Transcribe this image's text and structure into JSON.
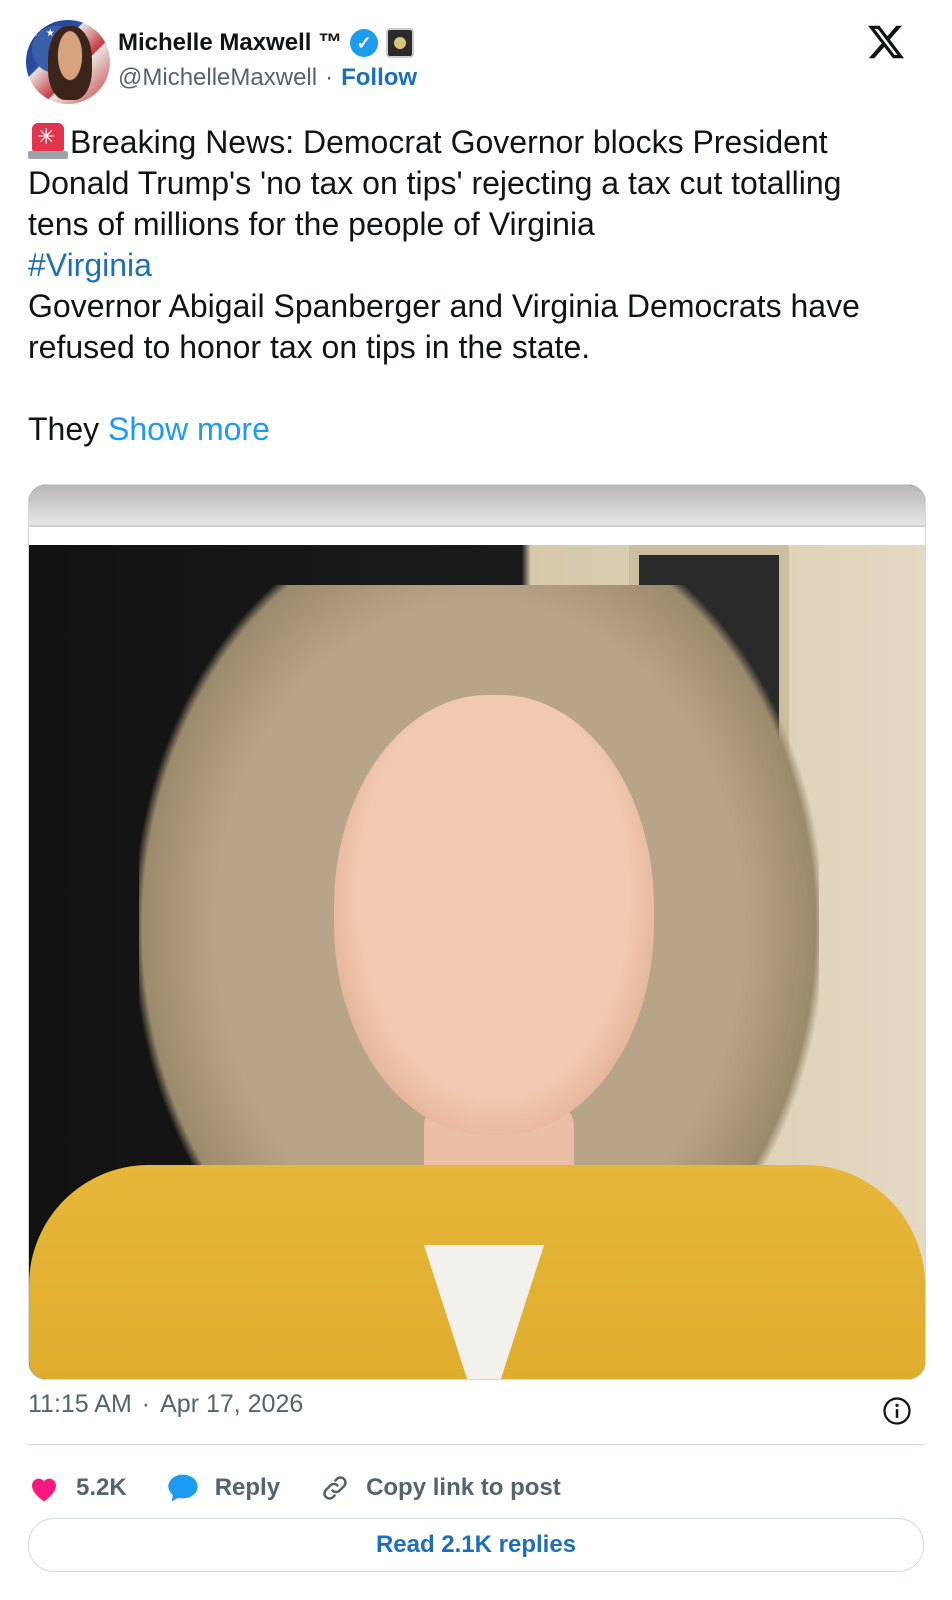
{
  "header": {
    "display_name": "Michelle Maxwell ™",
    "handle": "@MichelleMaxwell",
    "separator": "·",
    "follow_label": "Follow",
    "verified_icon": "verified-check-icon",
    "affiliation_icon": "affiliation-badge-icon",
    "platform_icon": "x-logo-icon"
  },
  "tweet": {
    "line1": "Breaking News: Democrat Governor blocks President Donald Trump's 'no tax on tips' rejecting a tax cut totalling tens of millions for the people of Virginia",
    "hashtag": "#Virginia",
    "line2": "Governor Abigail Spanberger and Virginia Democrats have refused to honor tax on tips in the state.",
    "line3": "They",
    "show_more": "Show more"
  },
  "meta": {
    "time": "11:15 AM",
    "separator": "·",
    "date": "Apr 17, 2026"
  },
  "actions": {
    "likes": "5.2K",
    "reply_label": "Reply",
    "copy_label": "Copy link to post"
  },
  "read_replies_label": "Read 2.1K replies",
  "colors": {
    "accent": "#1d9bf0",
    "link": "#1d6fb8",
    "like": "#f91880",
    "text": "#0f1419",
    "muted": "#536471"
  }
}
